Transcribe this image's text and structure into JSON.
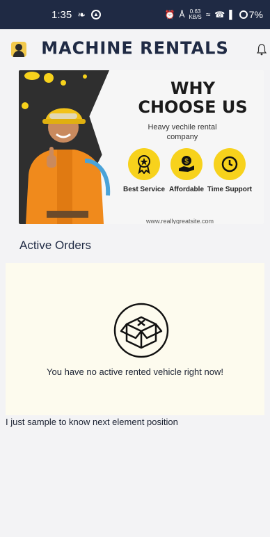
{
  "status_bar": {
    "time": "1:35",
    "net_speed_value": "0.63",
    "net_speed_unit": "KB/S",
    "battery": "7%"
  },
  "header": {
    "title": "MACHINE RENTALS",
    "avatar_icon": "user-avatar-icon",
    "bell_icon": "bell-icon"
  },
  "banner": {
    "title_line1": "WHY",
    "title_line2": "CHOOSE US",
    "subtitle": "Heavy vechile rental company",
    "features": [
      {
        "label": "Best Service",
        "icon": "award-icon"
      },
      {
        "label": "Affordable",
        "icon": "money-hand-icon"
      },
      {
        "label": "Time Support",
        "icon": "clock-icon"
      }
    ],
    "url": "www.reallygreatsite.com"
  },
  "orders": {
    "section_title": "Active Orders",
    "empty_icon": "empty-box-icon",
    "empty_message": "You have no active rented vehicle right now!"
  },
  "sample_text": "I just sample to know next element position",
  "colors": {
    "status_bar_bg": "#1f2a44",
    "accent_yellow": "#f7d21c",
    "panel_bg": "#fdfbee"
  }
}
